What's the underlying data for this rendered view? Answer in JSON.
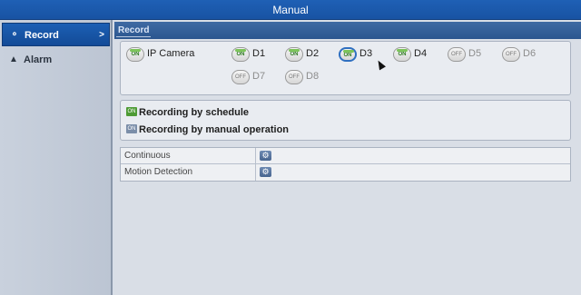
{
  "window": {
    "title": "Manual"
  },
  "sidebar": {
    "items": [
      {
        "label": "Record",
        "icon": "record-icon",
        "active": true
      },
      {
        "label": "Alarm",
        "icon": "alarm-icon",
        "active": false
      }
    ]
  },
  "main": {
    "tab": "Record",
    "cameras": [
      {
        "label": "IP Camera",
        "state": "ON",
        "selected": false
      },
      {
        "label": "D1",
        "state": "ON",
        "selected": false
      },
      {
        "label": "D2",
        "state": "ON",
        "selected": false
      },
      {
        "label": "D3",
        "state": "ON",
        "selected": true
      },
      {
        "label": "D4",
        "state": "ON",
        "selected": false
      },
      {
        "label": "D5",
        "state": "OFF",
        "selected": false
      },
      {
        "label": "D6",
        "state": "OFF",
        "selected": false
      },
      {
        "label": "D7",
        "state": "OFF",
        "selected": false
      },
      {
        "label": "D8",
        "state": "OFF",
        "selected": false
      }
    ],
    "modes": [
      {
        "label": "Recording by schedule",
        "badge": "ON"
      },
      {
        "label": "Recording by manual operation",
        "badge": "ON"
      }
    ],
    "rec_types": [
      {
        "label": "Continuous"
      },
      {
        "label": "Motion Detection"
      }
    ]
  },
  "colors": {
    "titlebar": "#1f60b5",
    "on_green": "#7cc45a",
    "selected": "#2f6fc0"
  }
}
